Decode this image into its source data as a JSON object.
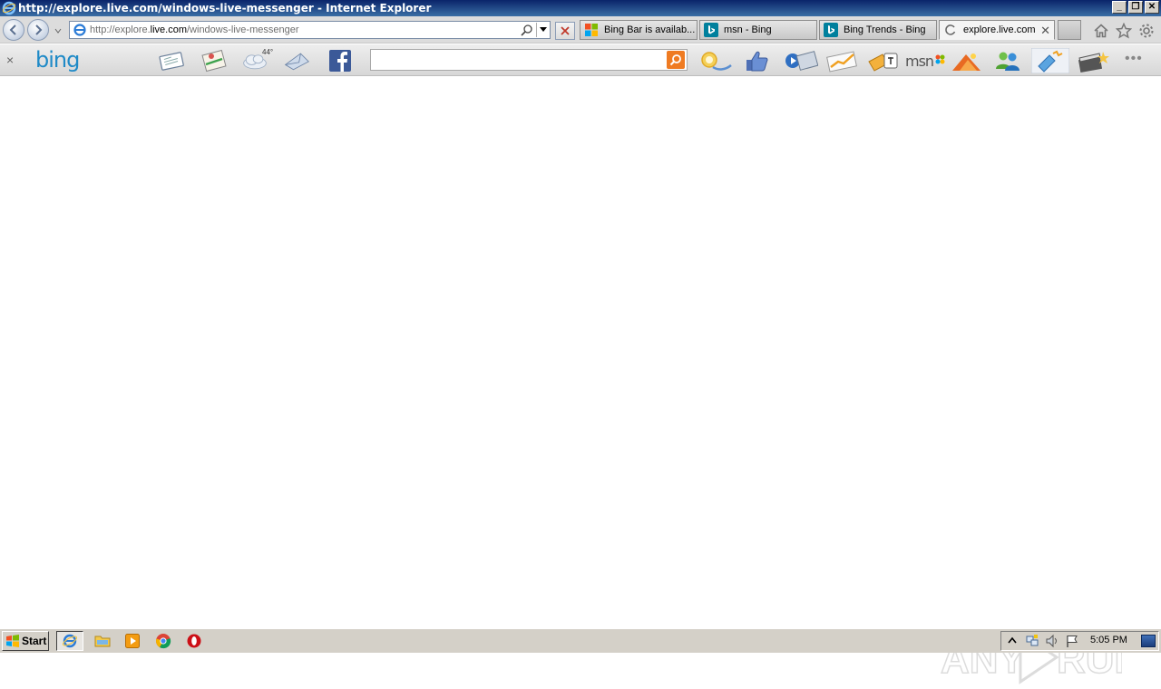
{
  "window": {
    "title": "http://explore.live.com/windows-live-messenger - Internet Explorer",
    "minimize": "_",
    "restore": "❐",
    "close": "✕"
  },
  "address": {
    "url_prefix": "http://explore.",
    "url_domain": "live.com",
    "url_path": "/windows-live-messenger"
  },
  "tabs": [
    {
      "label": "Bing Bar is availab...",
      "icon": "windows-flag-icon",
      "active": false
    },
    {
      "label": "msn - Bing",
      "icon": "bing-icon",
      "active": false
    },
    {
      "label": "Bing Trends - Bing",
      "icon": "bing-icon",
      "active": false
    },
    {
      "label": "explore.live.com",
      "icon": "loading-icon",
      "active": true
    }
  ],
  "tab_close": "✕",
  "bingbar": {
    "close": "×",
    "logo": "bing",
    "search_placeholder": "",
    "weather_temp": "44°",
    "msn": "msn",
    "more": "•••"
  },
  "taskbar": {
    "start_label": "Start",
    "clock": "5:05 PM"
  },
  "colors": {
    "title_gradient_start": "#0a246a",
    "title_gradient_end": "#3a6ea5",
    "bing_blue": "#1f8ac7",
    "search_orange": "#ef7b22",
    "taskbar": "#d4d0c8"
  }
}
